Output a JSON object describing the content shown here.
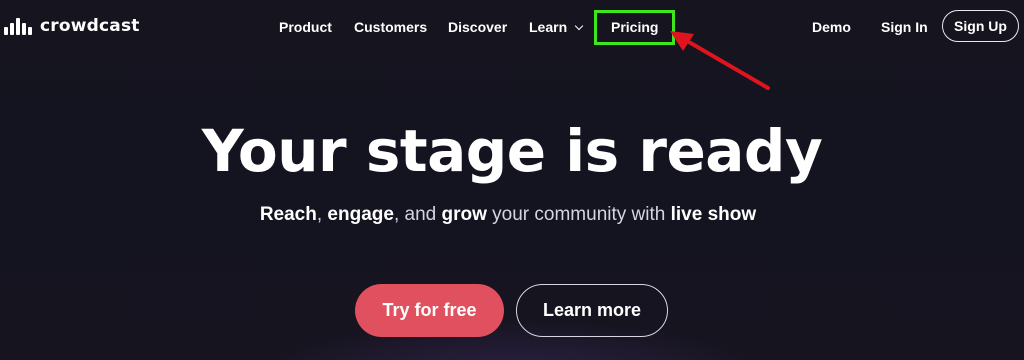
{
  "brand": {
    "name": "crowdcast",
    "logo_icon": "equalizer-bars-icon"
  },
  "nav": {
    "product": "Product",
    "customers": "Customers",
    "discover": "Discover",
    "learn": "Learn",
    "pricing": "Pricing",
    "demo": "Demo",
    "sign_in": "Sign In",
    "sign_up": "Sign Up"
  },
  "annotation": {
    "highlight_color": "#3ee61e",
    "arrow_color": "#e0141e"
  },
  "hero": {
    "title": "Your stage is ready",
    "subtitle": {
      "w1": "Reach",
      "s1": ", ",
      "w2": "engage",
      "s2": ", and ",
      "w3": "grow",
      "s3": " your community with ",
      "w4": "live show"
    },
    "primary_cta": "Try for free",
    "secondary_cta": "Learn more"
  },
  "colors": {
    "background": "#141320",
    "primary_button": "#e0505f"
  }
}
